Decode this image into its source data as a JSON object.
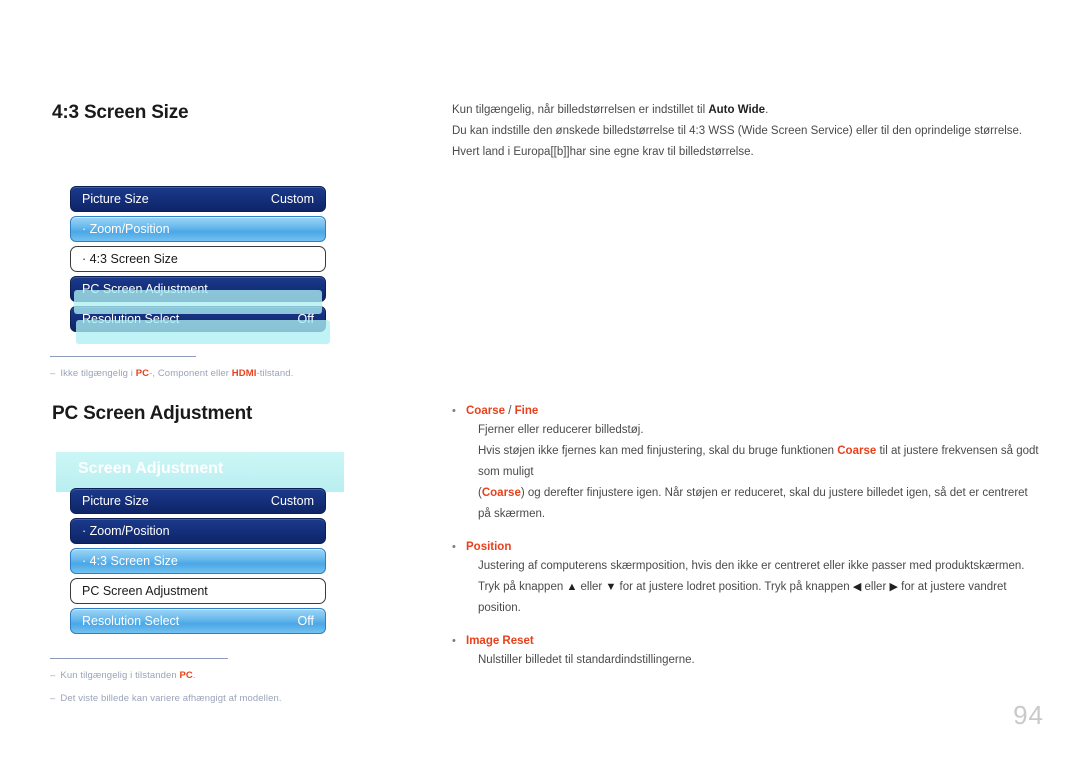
{
  "sections": {
    "first": {
      "title": "4:3 Screen Size",
      "intro_line_1_pre": "Kun tilgængelig, når billedstørrelsen er indstillet til ",
      "intro_line_1_bold": "Auto Wide",
      "intro_line_1_post": ".",
      "intro_line_2": "Du kan indstille den ønskede billedstørrelse til 4:3 WSS (Wide Screen Service) eller til den oprindelige størrelse.",
      "intro_line_3": "Hvert land i Europa[[b]]har sine egne krav til billedstørrelse.",
      "footnote": {
        "dash": "–",
        "pre": "Ikke tilgængelig i ",
        "hot1": "PC",
        "mid": "-, Component  eller ",
        "hot2": "HDMI",
        "post": "-tilstand."
      }
    },
    "second": {
      "title": "PC Screen Adjustment",
      "panel_title": "Screen Adjustment",
      "footnote_1": {
        "dash": "–",
        "pre": "Kun tilgængelig i tilstanden ",
        "hot": "PC",
        "post": "."
      },
      "footnote_2": {
        "dash": "–",
        "text": "Det viste billede kan variere afhængigt af modellen."
      }
    }
  },
  "osd_menu_1": {
    "rows": [
      {
        "label": "Picture Size",
        "value": "Custom",
        "style": "dark"
      },
      {
        "label": "· Zoom/Position",
        "value": "",
        "style": "highlight"
      },
      {
        "label": "· 4:3 Screen Size",
        "value": "",
        "style": "white"
      },
      {
        "label": "PC Screen Adjustment",
        "value": "",
        "style": "dark"
      },
      {
        "label": "Resolution Select",
        "value": "Off",
        "style": "dark"
      }
    ]
  },
  "osd_menu_2": {
    "rows": [
      {
        "label": "Picture Size",
        "value": "Custom",
        "style": "dark"
      },
      {
        "label": "· Zoom/Position",
        "value": "",
        "style": "dark"
      },
      {
        "label": "· 4:3 Screen Size",
        "value": "",
        "style": "highlight"
      },
      {
        "label": "PC Screen Adjustment",
        "value": "",
        "style": "white"
      },
      {
        "label": "Resolution Select",
        "value": "Off",
        "style": "highlight"
      }
    ]
  },
  "bullets": [
    {
      "marker": "•",
      "title_main": "Coarse",
      "title_sep": " / ",
      "title_alt": "Fine",
      "lines": [
        [
          {
            "t": "Fjerner eller reducerer billedstøj."
          }
        ],
        [
          {
            "t": "Hvis støjen ikke fjernes kan med finjustering, skal du bruge funktionen "
          },
          {
            "t": "Coarse",
            "hot": true
          },
          {
            "t": " til at justere frekvensen så godt som muligt"
          }
        ],
        [
          {
            "t": "("
          },
          {
            "t": "Coarse",
            "hot": true
          },
          {
            "t": ") og derefter finjustere igen. Når støjen er reduceret, skal du justere billedet igen, så det er centreret på skærmen."
          }
        ]
      ]
    },
    {
      "marker": "•",
      "title_main": "Position",
      "title_sep": "",
      "title_alt": "",
      "lines": [
        [
          {
            "t": "Justering af computerens skærmposition, hvis den ikke er centreret eller ikke passer med produktskærmen."
          }
        ],
        [
          {
            "t": "Tryk på knappen "
          },
          {
            "t": "▲",
            "arrow": true
          },
          {
            "t": " eller "
          },
          {
            "t": "▼",
            "arrow": true
          },
          {
            "t": " for at justere lodret position. Tryk på knappen "
          },
          {
            "t": "◀",
            "arrow": true
          },
          {
            "t": " eller "
          },
          {
            "t": "▶",
            "arrow": true
          },
          {
            "t": " for at justere vandret position."
          }
        ]
      ]
    },
    {
      "marker": "•",
      "title_main": "Image Reset",
      "title_sep": "",
      "title_alt": "",
      "lines": [
        [
          {
            "t": "Nulstiller billedet til standardindstillingerne."
          }
        ]
      ]
    }
  ],
  "page_number": "94",
  "colors": {
    "accent_red": "#e8411c",
    "menu_dark": "#15307c",
    "menu_highlight": "#4aa7e6",
    "panel_cyan": "#c2f2f3",
    "footnote_gray": "#9aa3b8"
  }
}
